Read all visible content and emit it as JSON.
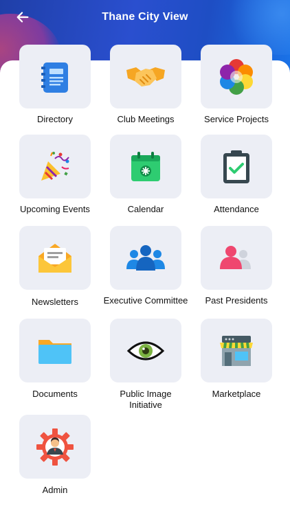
{
  "header": {
    "title": "Thane City View",
    "back_icon": "arrow-left-icon"
  },
  "menu": [
    {
      "label": "Directory",
      "icon": "notebook-icon"
    },
    {
      "label": "Club Meetings",
      "icon": "handshake-icon"
    },
    {
      "label": "Service Projects",
      "icon": "flower-icon"
    },
    {
      "label": "Upcoming Events",
      "icon": "party-popper-icon"
    },
    {
      "label": "Calendar",
      "icon": "calendar-icon"
    },
    {
      "label": "Attendance",
      "icon": "clipboard-check-icon"
    },
    {
      "label": "Newsletters",
      "icon": "envelope-icon"
    },
    {
      "label": "Executive Committee",
      "icon": "group-icon"
    },
    {
      "label": "Past Presidents",
      "icon": "two-people-icon"
    },
    {
      "label": "Documents",
      "icon": "folder-icon"
    },
    {
      "label": "Public Image\nInitiative",
      "icon": "eye-icon"
    },
    {
      "label": "Marketplace",
      "icon": "storefront-icon"
    },
    {
      "label": "Admin",
      "icon": "admin-gear-icon"
    }
  ],
  "colors": {
    "header": "#2a4fcf",
    "tile": "#eceef5"
  }
}
